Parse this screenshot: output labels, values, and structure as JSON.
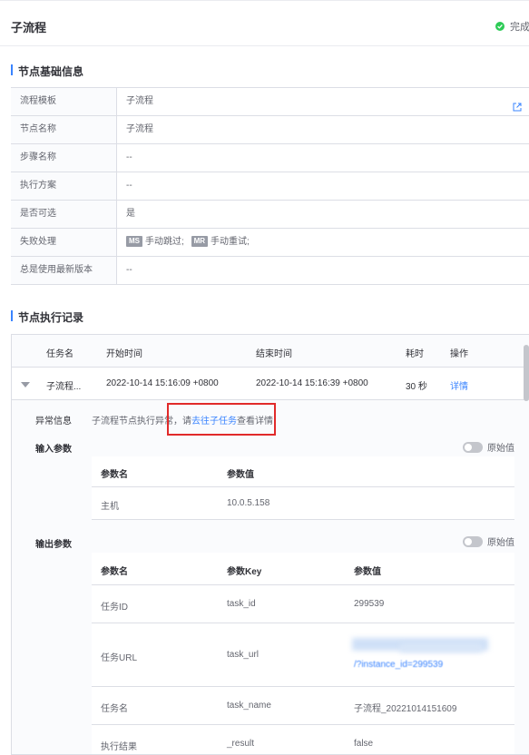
{
  "header": {
    "title": "子流程",
    "status_text": "完成",
    "status_color": "#2dcb56"
  },
  "basic_info": {
    "section_title": "节点基础信息",
    "rows": [
      {
        "label": "流程模板",
        "value": "子流程"
      },
      {
        "label": "节点名称",
        "value": "子流程"
      },
      {
        "label": "步骤名称",
        "value": "--"
      },
      {
        "label": "执行方案",
        "value": "--"
      },
      {
        "label": "是否可选",
        "value": "是"
      },
      {
        "label": "失败处理",
        "tag1": "MS",
        "text1": "手动跳过;",
        "tag2": "MR",
        "text2": "手动重试;"
      },
      {
        "label": "总是使用最新版本",
        "value": "--"
      }
    ]
  },
  "exec_records": {
    "section_title": "节点执行记录",
    "columns": {
      "task_name": "任务名",
      "start_time": "开始时间",
      "end_time": "结束时间",
      "duration": "耗时",
      "action": "操作"
    },
    "row": {
      "task_name": "子流程...",
      "start_time": "2022-10-14 15:16:09 +0800",
      "end_time": "2022-10-14 15:16:39 +0800",
      "duration": "30 秒",
      "action": "详情"
    },
    "detail": {
      "error_label": "异常信息",
      "error_prefix": "子流程节点执行异常，请",
      "error_link": "去往子任务",
      "error_suffix": "查看详情",
      "input_label": "输入参数",
      "output_label": "输出参数",
      "raw_toggle_label": "原始值",
      "input_table": {
        "headers": {
          "name": "参数名",
          "value": "参数值"
        },
        "rows": [
          {
            "name": "主机",
            "value": "10.0.5.158"
          }
        ]
      },
      "output_table": {
        "headers": {
          "name": "参数名",
          "key": "参数Key",
          "value": "参数值"
        },
        "rows": [
          {
            "name": "任务ID",
            "key": "task_id",
            "value": "299539"
          },
          {
            "name": "任务URL",
            "key": "task_url",
            "value": "/?instance_id=299539"
          },
          {
            "name": "任务名",
            "key": "task_name",
            "value": "子流程_20221014151609"
          },
          {
            "name": "执行结果",
            "key": "_result",
            "value": "false"
          }
        ]
      }
    }
  },
  "accent_color": "#3a84ff",
  "highlight_color": "#e12a2a"
}
